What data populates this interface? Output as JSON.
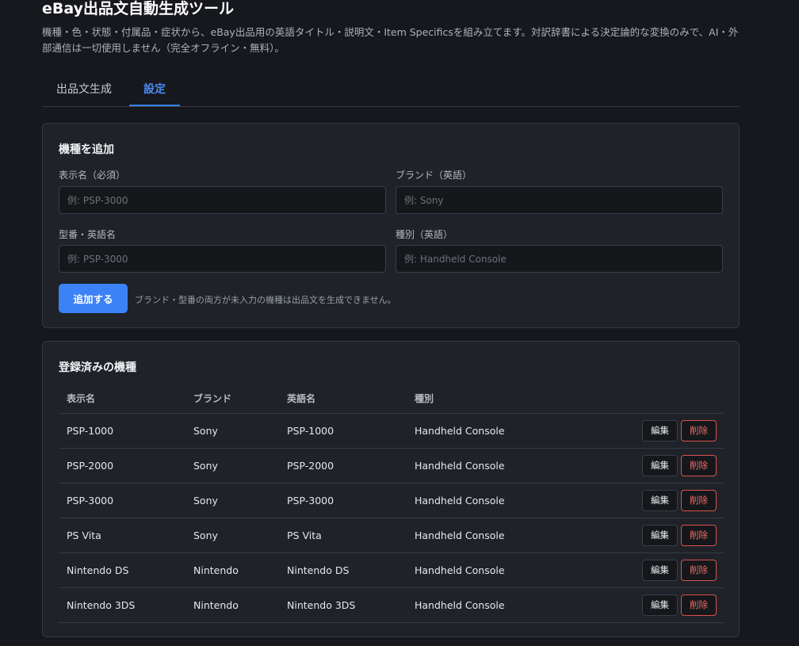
{
  "app": {
    "title": "eBay出品文自動生成ツール",
    "description": "機種・色・状態・付属品・症状から、eBay出品用の英語タイトル・説明文・Item Specificsを組み立てます。対訳辞書による決定論的な変換のみで、AI・外部通信は一切使用しません（完全オフライン・無料）。"
  },
  "tabs": [
    {
      "label": "出品文生成",
      "active": false
    },
    {
      "label": "設定",
      "active": true
    }
  ],
  "add_form": {
    "title": "機種を追加",
    "display_name": {
      "label": "表示名（必須）",
      "placeholder": "例: PSP-3000",
      "value": ""
    },
    "brand": {
      "label": "ブランド（英語）",
      "placeholder": "例: Sony",
      "value": ""
    },
    "model": {
      "label": "型番・英語名",
      "placeholder": "例: PSP-3000",
      "value": ""
    },
    "type": {
      "label": "種別（英語）",
      "placeholder": "例: Handheld Console",
      "value": ""
    },
    "submit_label": "追加する",
    "hint": "ブランド・型番の両方が未入力の機種は出品文を生成できません。"
  },
  "registered": {
    "title": "登録済みの機種",
    "columns": [
      "表示名",
      "ブランド",
      "英語名",
      "種別"
    ],
    "edit_label": "編集",
    "delete_label": "削除",
    "rows": [
      {
        "display": "PSP-1000",
        "brand": "Sony",
        "english": "PSP-1000",
        "type": "Handheld Console"
      },
      {
        "display": "PSP-2000",
        "brand": "Sony",
        "english": "PSP-2000",
        "type": "Handheld Console"
      },
      {
        "display": "PSP-3000",
        "brand": "Sony",
        "english": "PSP-3000",
        "type": "Handheld Console"
      },
      {
        "display": "PS Vita",
        "brand": "Sony",
        "english": "PS Vita",
        "type": "Handheld Console"
      },
      {
        "display": "Nintendo DS",
        "brand": "Nintendo",
        "english": "Nintendo DS",
        "type": "Handheld Console"
      },
      {
        "display": "Nintendo 3DS",
        "brand": "Nintendo",
        "english": "Nintendo 3DS",
        "type": "Handheld Console"
      }
    ]
  },
  "colors": {
    "accent": "#3b82f6",
    "danger": "#f06c67",
    "background": "#16181d",
    "card": "#1f2228"
  }
}
